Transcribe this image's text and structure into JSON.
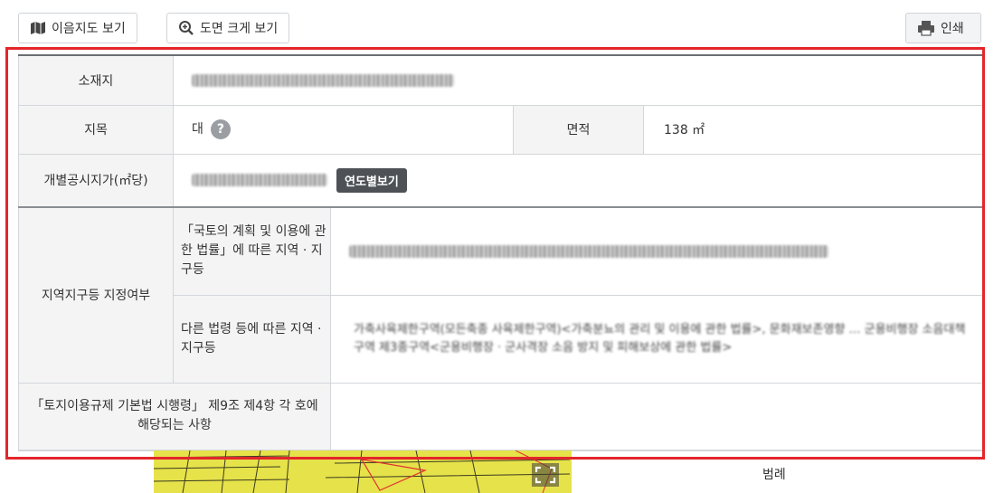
{
  "toolbar": {
    "map_button_label": "이음지도 보기",
    "zoom_button_label": "도면 크게 보기",
    "print_button_label": "인쇄"
  },
  "land_info": {
    "location": {
      "label": "소재지"
    },
    "land_category": {
      "label": "지목",
      "value": "대"
    },
    "area": {
      "label": "면적",
      "value": "138 ㎡"
    },
    "official_price": {
      "label": "개별공시지가(㎡당)",
      "year_button": "연도별보기"
    },
    "zoning": {
      "label": "지역지구등 지정여부",
      "national_land_law": {
        "label": "「국토의 계획 및 이용에 관한 법률」에 따른 지역 · 지구등"
      },
      "other_laws": {
        "label": "다른 법령 등에 따른 지역 · 지구등",
        "text": "가축사육제한구역(모든축종 사육제한구역)<가축분뇨의 관리 및 이용에 관한 법률>, 문화재보존영향 … 군용비행장 소음대책구역 제3종구역<군용비행장 · 군사격장 소음 방지 및 피해보상에 관한 법률>"
      }
    },
    "regulation": {
      "label": "「토지이용규제 기본법 시행령」 제9조 제4항 각 호에 해당되는 사항"
    }
  },
  "map": {
    "legend_title": "범례",
    "fullscreen_icon": "expand-icon"
  },
  "colors": {
    "highlight": "#e3262b",
    "map_fill": "#e6e24a",
    "year_button": "#4e5257"
  }
}
